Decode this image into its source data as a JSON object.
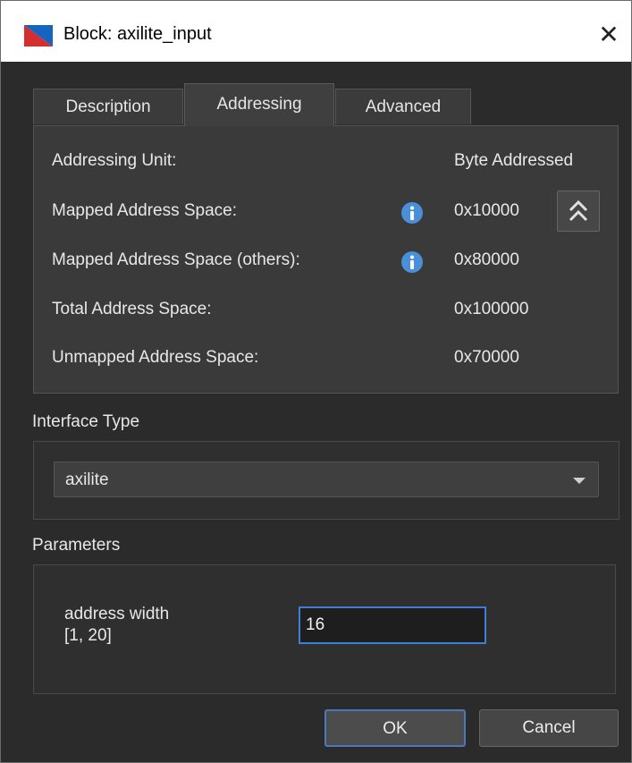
{
  "window": {
    "title": "Block: axilite_input",
    "close_glyph": "✕"
  },
  "icons": {
    "app": "block-app-icon",
    "info": "info-icon",
    "collapse": "double-chevron-up-icon",
    "dropdown": "chevron-down-icon"
  },
  "colors": {
    "accent": "#3d7fd6",
    "info": "#4a90d9",
    "app_red": "#d32f2f",
    "app_blue": "#1565c0"
  },
  "tabs": [
    {
      "label": "Description",
      "active": false
    },
    {
      "label": "Addressing",
      "active": true
    },
    {
      "label": "Advanced",
      "active": false
    }
  ],
  "addressing": {
    "rows": [
      {
        "label": "Addressing Unit:",
        "value": "Byte Addressed"
      },
      {
        "label": "Mapped Address Space:",
        "value": "0x10000"
      },
      {
        "label": "Mapped Address Space (others):",
        "value": "0x80000"
      },
      {
        "label": "Total Address Space:",
        "value": "0x100000"
      },
      {
        "label": "Unmapped Address Space:",
        "value": "0x70000"
      }
    ]
  },
  "interface": {
    "section_label": "Interface Type",
    "selected": "axilite"
  },
  "parameters": {
    "section_label": "Parameters",
    "address_width_label": "address width",
    "address_width_range": "[1, 20]",
    "address_width_value": "16"
  },
  "buttons": {
    "ok": "OK",
    "cancel": "Cancel"
  }
}
